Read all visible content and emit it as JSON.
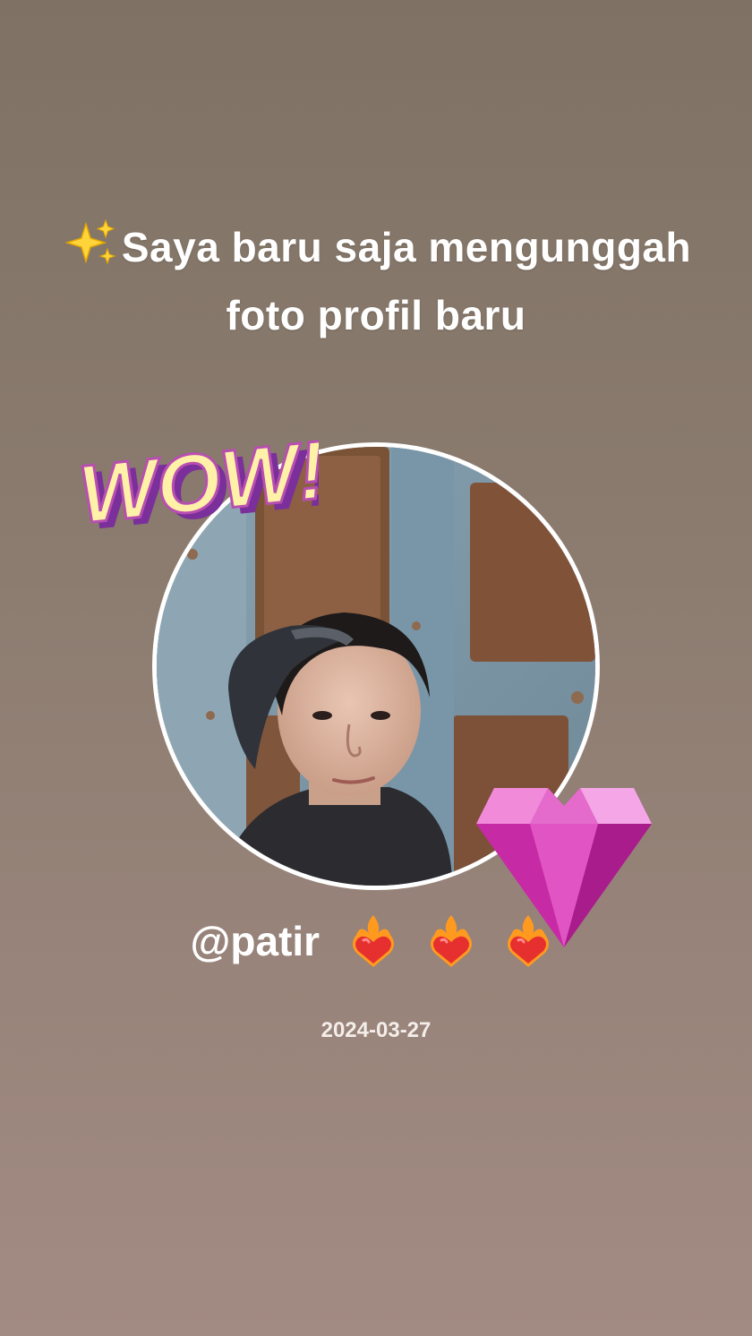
{
  "headline": {
    "emoji": "sparkles-icon",
    "text": "Saya baru saja menunggah foto profil baru"
  },
  "headline_display": "Saya baru saja mengunggah foto profil baru",
  "stickers": {
    "wow": "WOW!",
    "gem": "pink-gem-heart-icon"
  },
  "profile": {
    "username": "@patir",
    "emoji_icons": [
      "heart-on-fire-icon",
      "heart-on-fire-icon",
      "heart-on-fire-icon"
    ]
  },
  "date": "2024-03-27",
  "colors": {
    "background_top": "#7f7264",
    "background_bottom": "#a28b83",
    "text": "#ffffff",
    "ring": "#ffffff",
    "gem_pink": "#d63cb5"
  }
}
